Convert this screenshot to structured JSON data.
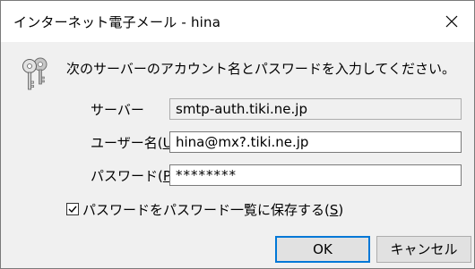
{
  "window": {
    "title": "インターネット電子メール - hina",
    "close_symbol": "✕"
  },
  "prompt": "次のサーバーのアカウント名とパスワードを入力してください。",
  "server": {
    "label": "サーバー",
    "value": "smtp-auth.tiki.ne.jp"
  },
  "username": {
    "label_text": "ユーザー名(",
    "label_mnemonic": "U",
    "label_end": "):",
    "value": "hina@mx?.tiki.ne.jp"
  },
  "password": {
    "label_text": "パスワード(",
    "label_mnemonic": "P",
    "label_end": "):",
    "value": "********"
  },
  "save_password": {
    "checked": true,
    "label_text": "パスワードをパスワード一覧に保存する(",
    "label_mnemonic": "S",
    "label_end": ")"
  },
  "buttons": {
    "ok": "OK",
    "cancel": "キャンセル"
  },
  "colors": {
    "focus_border": "#0078d7",
    "dialog_bg": "#f0f0f0"
  },
  "icons": {
    "dialog": "key-icon",
    "close": "close-icon",
    "checkbox": "checkmark-icon"
  }
}
